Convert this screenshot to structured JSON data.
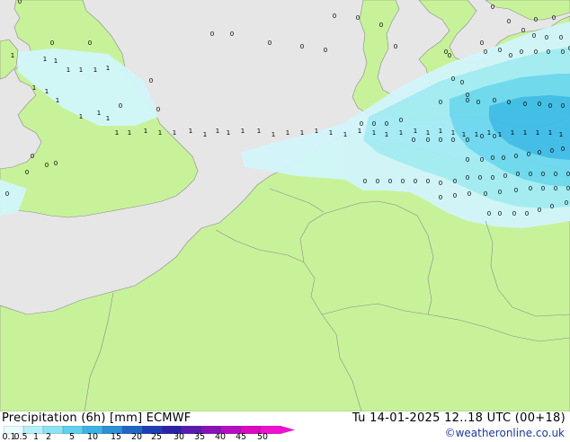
{
  "title": {
    "left_main": "Precipitation (6h) [mm]",
    "left_model": "ECMWF",
    "right": "Tu 14-01-2025 12..18 UTC (00+18)"
  },
  "credit": "©weatheronline.co.uk",
  "colorbar": {
    "labels": [
      "0.1",
      "0.5",
      "1",
      "2",
      "5",
      "10",
      "15",
      "20",
      "25",
      "30",
      "35",
      "40",
      "45",
      "50"
    ],
    "colors": [
      "#e8fbff",
      "#b4f0fa",
      "#8be4f5",
      "#5cd2ee",
      "#3ab4e6",
      "#2a90d8",
      "#2066c8",
      "#1b40b4",
      "#2c22a8",
      "#5a1ab0",
      "#8a10b8",
      "#b80cc0",
      "#dc08c4",
      "#f010d0"
    ]
  },
  "colors": {
    "sea": "#e6e6e6",
    "land": "#c8f29a",
    "border": "#8a8a8a",
    "precip_light": "#d2f6fb",
    "precip_mid": "#a4ecf6",
    "precip_heavy": "#6cd8f0",
    "precip_max": "#3cbce8"
  },
  "grid_values": [
    {
      "label": "0",
      "pts": [
        [
          22,
          4
        ],
        [
          58,
          50
        ],
        [
          100,
          50
        ],
        [
          168,
          92
        ],
        [
          134,
          120
        ],
        [
          176,
          124
        ],
        [
          236,
          40
        ],
        [
          258,
          40
        ],
        [
          300,
          50
        ],
        [
          336,
          54
        ],
        [
          362,
          58
        ],
        [
          372,
          20
        ],
        [
          398,
          22
        ],
        [
          424,
          30
        ],
        [
          440,
          54
        ],
        [
          496,
          60
        ],
        [
          500,
          64
        ],
        [
          504,
          90
        ],
        [
          514,
          94
        ],
        [
          520,
          108
        ],
        [
          548,
          10
        ],
        [
          566,
          26
        ],
        [
          582,
          36
        ],
        [
          594,
          42
        ],
        [
          608,
          44
        ],
        [
          624,
          44
        ],
        [
          634,
          56
        ],
        [
          596,
          24
        ],
        [
          616,
          22
        ],
        [
          536,
          50
        ],
        [
          540,
          60
        ],
        [
          556,
          58
        ],
        [
          568,
          64
        ],
        [
          580,
          60
        ],
        [
          596,
          60
        ],
        [
          610,
          60
        ],
        [
          626,
          60
        ],
        [
          490,
          116
        ],
        [
          520,
          114
        ],
        [
          532,
          116
        ],
        [
          550,
          114
        ],
        [
          566,
          116
        ],
        [
          584,
          118
        ],
        [
          600,
          118
        ],
        [
          612,
          120
        ],
        [
          626,
          120
        ]
      ]
    },
    {
      "label": "1",
      "pts": [
        [
          14,
          64
        ],
        [
          50,
          68
        ],
        [
          62,
          70
        ],
        [
          76,
          80
        ],
        [
          90,
          80
        ],
        [
          106,
          80
        ],
        [
          120,
          78
        ],
        [
          38,
          100
        ],
        [
          52,
          104
        ],
        [
          64,
          114
        ],
        [
          90,
          132
        ],
        [
          110,
          128
        ],
        [
          120,
          134
        ],
        [
          130,
          150
        ],
        [
          144,
          150
        ],
        [
          162,
          148
        ],
        [
          178,
          150
        ],
        [
          194,
          150
        ],
        [
          212,
          148
        ],
        [
          228,
          152
        ],
        [
          242,
          148
        ],
        [
          254,
          150
        ],
        [
          270,
          148
        ],
        [
          288,
          148
        ],
        [
          304,
          152
        ],
        [
          320,
          150
        ],
        [
          336,
          150
        ],
        [
          352,
          148
        ],
        [
          368,
          150
        ],
        [
          384,
          152
        ],
        [
          400,
          148
        ],
        [
          416,
          150
        ],
        [
          430,
          152
        ],
        [
          446,
          150
        ],
        [
          462,
          148
        ],
        [
          476,
          150
        ],
        [
          490,
          148
        ],
        [
          504,
          150
        ],
        [
          516,
          152
        ],
        [
          530,
          152
        ],
        [
          544,
          150
        ],
        [
          556,
          152
        ],
        [
          570,
          150
        ],
        [
          584,
          150
        ],
        [
          598,
          150
        ],
        [
          612,
          150
        ],
        [
          624,
          152
        ]
      ]
    },
    {
      "label": "0",
      "pts": [
        [
          36,
          176
        ],
        [
          52,
          186
        ],
        [
          62,
          184
        ],
        [
          30,
          194
        ],
        [
          8,
          218
        ],
        [
          402,
          140
        ],
        [
          416,
          140
        ],
        [
          430,
          140
        ],
        [
          446,
          136
        ],
        [
          460,
          158
        ],
        [
          476,
          158
        ],
        [
          490,
          158
        ],
        [
          504,
          158
        ],
        [
          520,
          158
        ],
        [
          536,
          154
        ],
        [
          550,
          154
        ],
        [
          520,
          180
        ],
        [
          536,
          180
        ],
        [
          548,
          178
        ],
        [
          560,
          178
        ],
        [
          574,
          176
        ],
        [
          588,
          174
        ],
        [
          600,
          172
        ],
        [
          614,
          170
        ],
        [
          626,
          168
        ],
        [
          406,
          204
        ],
        [
          420,
          204
        ],
        [
          434,
          204
        ],
        [
          448,
          204
        ],
        [
          462,
          204
        ],
        [
          476,
          204
        ],
        [
          490,
          206
        ],
        [
          506,
          204
        ],
        [
          520,
          200
        ],
        [
          534,
          200
        ],
        [
          548,
          200
        ],
        [
          562,
          198
        ],
        [
          576,
          196
        ],
        [
          590,
          196
        ],
        [
          604,
          196
        ],
        [
          618,
          196
        ],
        [
          632,
          196
        ],
        [
          490,
          222
        ],
        [
          506,
          220
        ],
        [
          522,
          218
        ],
        [
          540,
          218
        ],
        [
          556,
          216
        ],
        [
          574,
          214
        ],
        [
          590,
          212
        ],
        [
          604,
          212
        ],
        [
          618,
          212
        ],
        [
          632,
          212
        ],
        [
          544,
          240
        ],
        [
          556,
          240
        ],
        [
          572,
          240
        ],
        [
          586,
          240
        ],
        [
          600,
          236
        ],
        [
          614,
          232
        ],
        [
          630,
          228
        ]
      ]
    }
  ]
}
